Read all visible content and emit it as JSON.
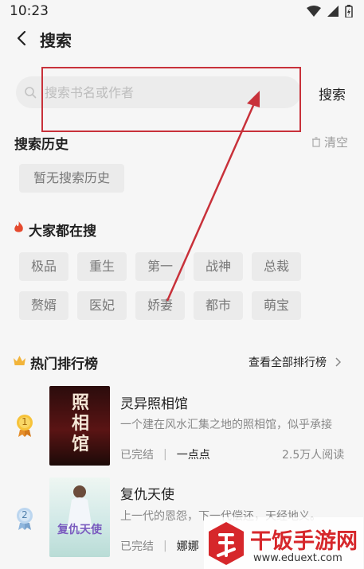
{
  "status": {
    "time": "10:23"
  },
  "header": {
    "title": "搜索"
  },
  "search": {
    "placeholder": "搜索书名或作者",
    "button": "搜索"
  },
  "history": {
    "title": "搜索历史",
    "clear": "清空",
    "empty": "暂无搜索历史"
  },
  "trending": {
    "title": "大家都在搜",
    "tags": [
      "极品",
      "重生",
      "第一",
      "战神",
      "总裁",
      "赘婿",
      "医妃",
      "娇妻",
      "都市",
      "萌宝"
    ]
  },
  "ranking": {
    "title": "热门排行榜",
    "view_all": "查看全部排行榜",
    "books": [
      {
        "rank": "1",
        "title": "灵异照相馆",
        "desc": "一个建在风水汇集之地的照相馆，似乎承接",
        "status": "已完结",
        "author": "一点点",
        "readers": "2.5万人阅读",
        "cover_text": "照相馆"
      },
      {
        "rank": "2",
        "title": "复仇天使",
        "desc": "上一代的恩怨，下一代偿还，天经地义。",
        "status": "已完结",
        "author": "娜娜",
        "readers": "",
        "cover_text": "复仇天使"
      }
    ]
  },
  "watermark": {
    "text": "干饭手游网",
    "url": "www.eduext.com"
  },
  "colors": {
    "annotation": "#c8313a",
    "fire": "#e54a2e",
    "crown": "#f2b43a",
    "watermark": "#d6272b"
  }
}
